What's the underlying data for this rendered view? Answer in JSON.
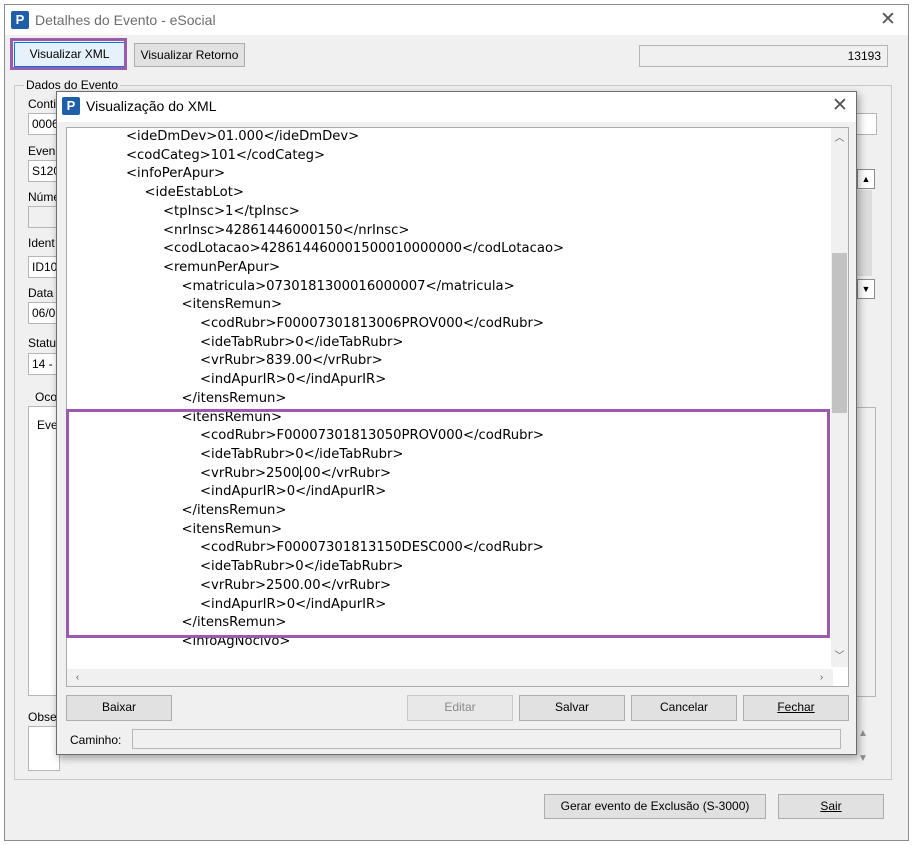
{
  "main_window": {
    "title": "Detalhes do Evento - eSocial",
    "logo_letter": "P",
    "buttons": {
      "visualizar_xml": "Visualizar XML",
      "visualizar_retorno": "Visualizar Retorno"
    },
    "number_field": "13193",
    "group_title": "Dados do Evento",
    "partial_labels": [
      "Conti",
      "Even",
      "Núme",
      "Ident",
      "Data",
      "Statu",
      "Oco",
      "Obse"
    ],
    "partial_values": [
      "0006",
      "S120",
      "",
      "ID10",
      "06/0",
      "14 - ",
      "Eve"
    ],
    "bottom_buttons": {
      "gerar_exclusao": "Gerar evento de Exclusão (S-3000)",
      "sair": "Sair"
    }
  },
  "xml_dialog": {
    "title": "Visualização do XML",
    "lines": [
      {
        "indent": 0,
        "text": "<ideDmDev>01.000</ideDmDev>"
      },
      {
        "indent": 0,
        "text": "<codCateg>101</codCateg>"
      },
      {
        "indent": 0,
        "text": "<infoPerApur>"
      },
      {
        "indent": 1,
        "text": "<ideEstabLot>"
      },
      {
        "indent": 2,
        "text": "<tpInsc>1</tpInsc>"
      },
      {
        "indent": 2,
        "text": "<nrInsc>42861446000150</nrInsc>"
      },
      {
        "indent": 2,
        "text": "<codLotacao>428614460001500010000000</codLotacao>"
      },
      {
        "indent": 2,
        "text": "<remunPerApur>"
      },
      {
        "indent": 3,
        "text": "<matricula>0730181300016000007</matricula>"
      },
      {
        "indent": 3,
        "text": "<itensRemun>"
      },
      {
        "indent": 4,
        "text": "<codRubr>F00007301813006PROV000</codRubr>"
      },
      {
        "indent": 4,
        "text": "<ideTabRubr>0</ideTabRubr>"
      },
      {
        "indent": 4,
        "text": "<vrRubr>839.00</vrRubr>"
      },
      {
        "indent": 4,
        "text": "<indApurIR>0</indApurIR>"
      },
      {
        "indent": 3,
        "text": "</itensRemun>"
      },
      {
        "indent": 3,
        "text": "<itensRemun>"
      },
      {
        "indent": 4,
        "text": "<codRubr>F00007301813050PROV000</codRubr>"
      },
      {
        "indent": 4,
        "text": "<ideTabRubr>0</ideTabRubr>"
      },
      {
        "indent": 4,
        "text": "<vrRubr>2500.00</vrRubr>",
        "caret_after": 12
      },
      {
        "indent": 4,
        "text": "<indApurIR>0</indApurIR>"
      },
      {
        "indent": 3,
        "text": "</itensRemun>"
      },
      {
        "indent": 3,
        "text": "<itensRemun>"
      },
      {
        "indent": 4,
        "text": "<codRubr>F00007301813150DESC000</codRubr>"
      },
      {
        "indent": 4,
        "text": "<ideTabRubr>0</ideTabRubr>"
      },
      {
        "indent": 4,
        "text": "<vrRubr>2500.00</vrRubr>"
      },
      {
        "indent": 4,
        "text": "<indApurIR>0</indApurIR>"
      },
      {
        "indent": 3,
        "text": "</itensRemun>"
      },
      {
        "indent": 3,
        "text": "<infoAgNocivo>"
      }
    ],
    "buttons": {
      "baixar": "Baixar",
      "editar": "Editar",
      "salvar": "Salvar",
      "cancelar": "Cancelar",
      "fechar": "Fechar"
    },
    "path_label": "Caminho:",
    "path_value": ""
  },
  "colors": {
    "highlight": "#9b59b0",
    "accent": "#0078d7",
    "logo": "#1f5fa8"
  }
}
